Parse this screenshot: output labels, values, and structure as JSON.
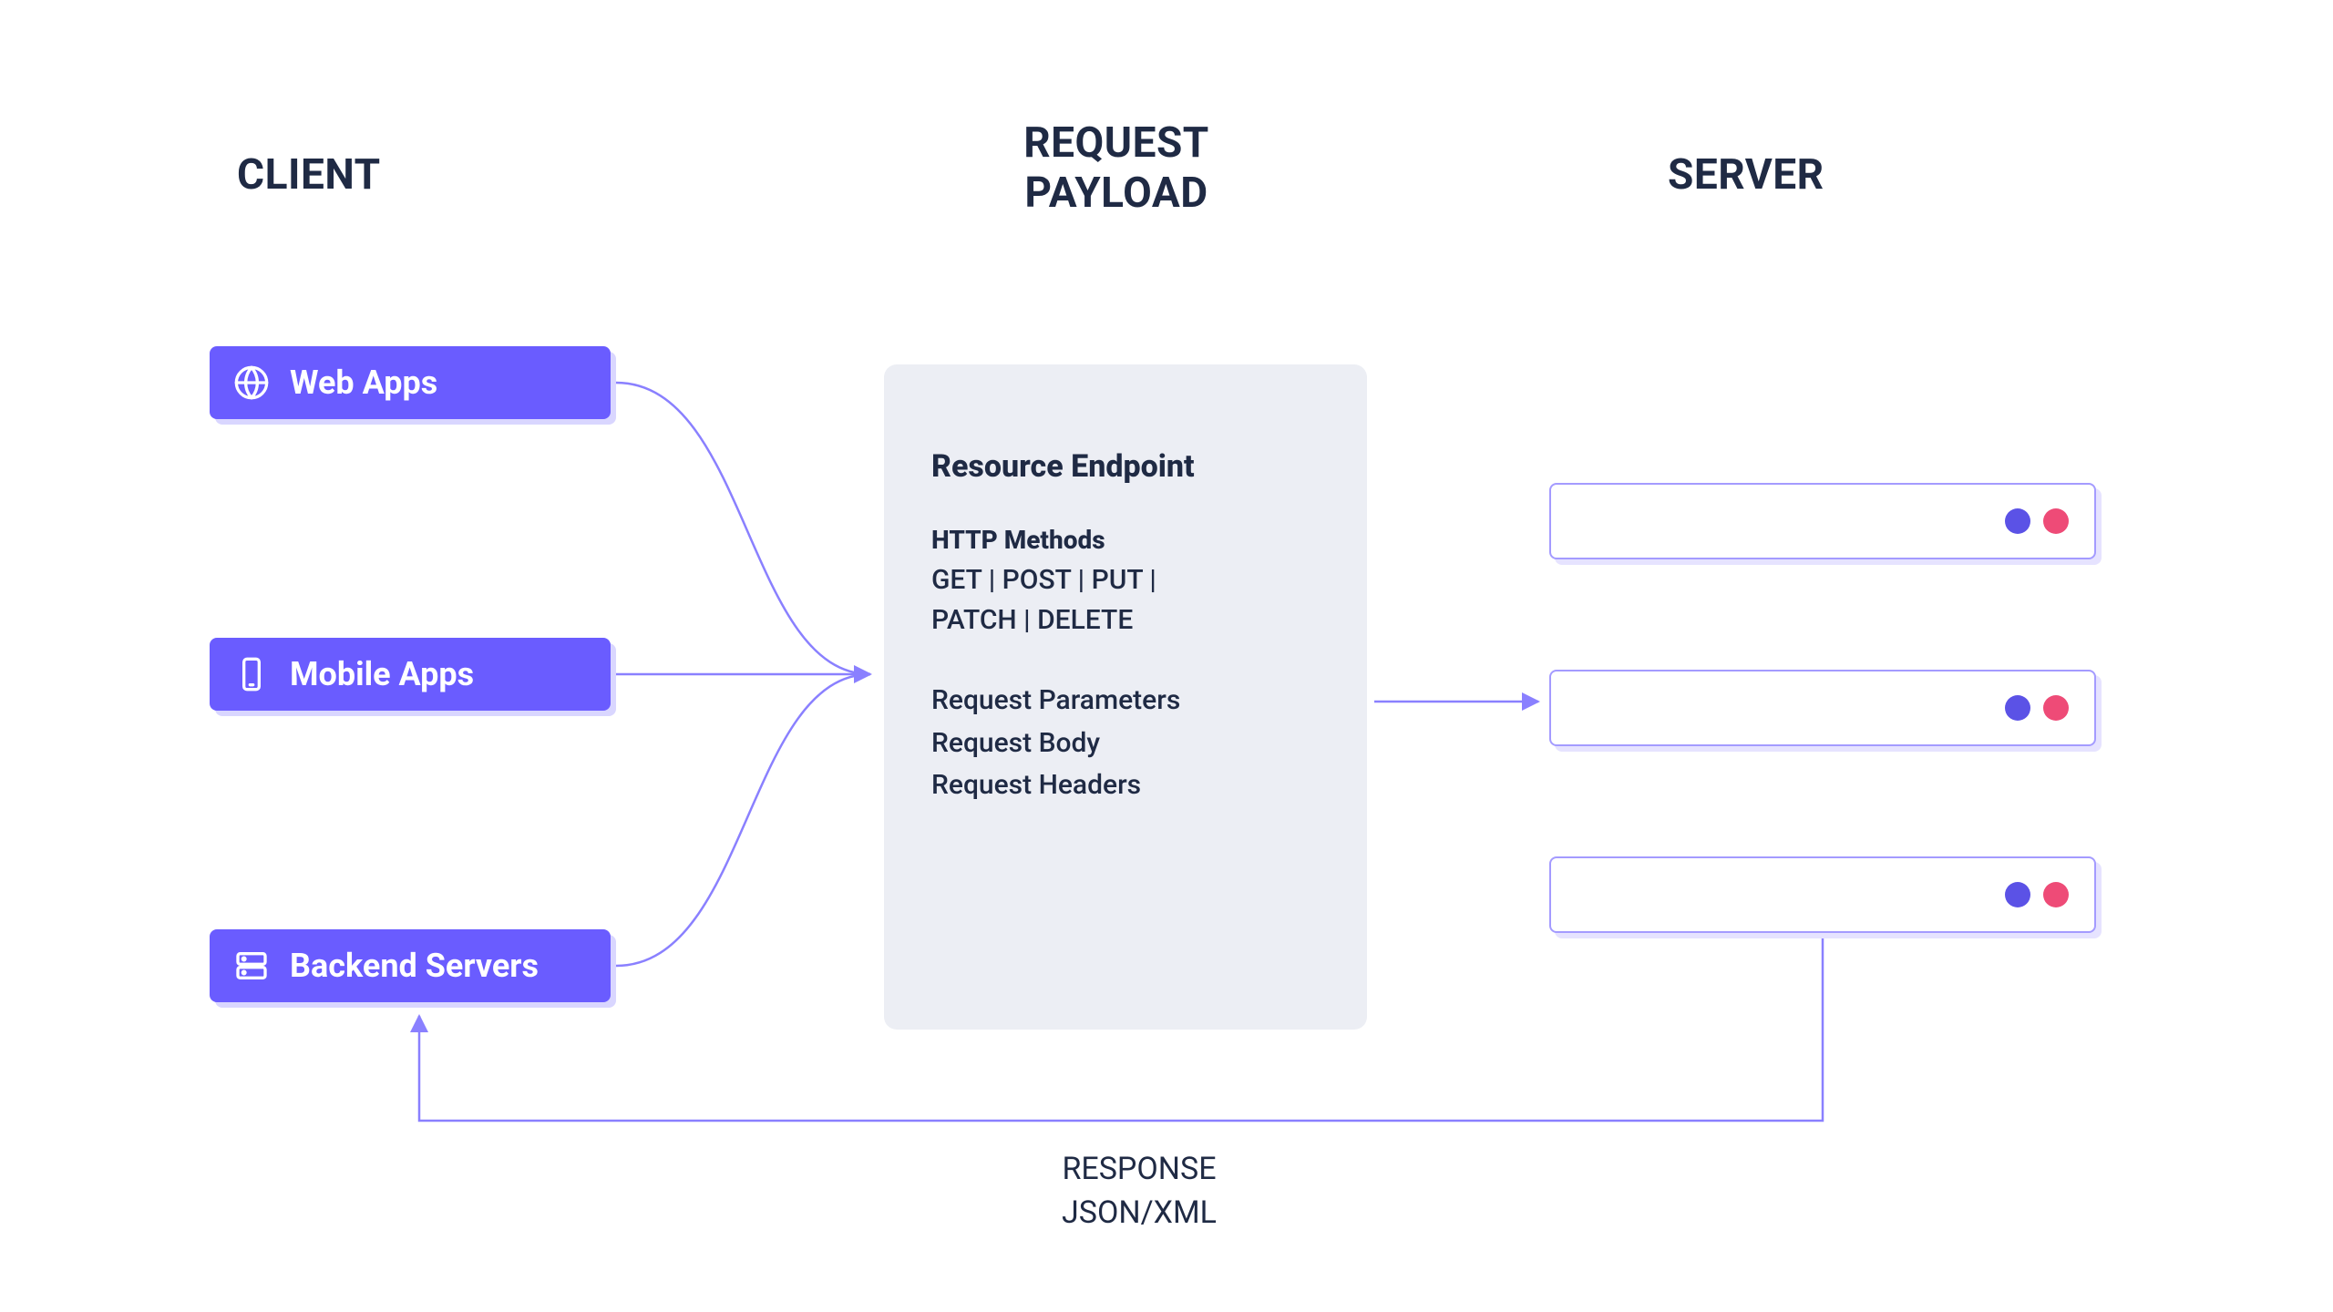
{
  "headings": {
    "client": "CLIENT",
    "request_line1": "REQUEST",
    "request_line2": "PAYLOAD",
    "server": "SERVER"
  },
  "clients": {
    "web": "Web Apps",
    "mobile": "Mobile Apps",
    "backend": "Backend Servers"
  },
  "payload": {
    "title": "Resource Endpoint",
    "http_heading": "HTTP Methods",
    "methods_line1": "GET | POST | PUT |",
    "methods_line2": "PATCH | DELETE",
    "item1": "Request Parameters",
    "item2": "Request Body",
    "item3": "Request Headers"
  },
  "response": {
    "line1": "RESPONSE",
    "line2": "JSON/XML"
  },
  "colors": {
    "primary": "#6a5cff",
    "primary_light": "#a49bff",
    "shadow": "#d9d6ff",
    "panel": "#eceef4",
    "text": "#1f2a44",
    "dot_blue": "#5b52e6",
    "dot_pink": "#ee4b77"
  }
}
